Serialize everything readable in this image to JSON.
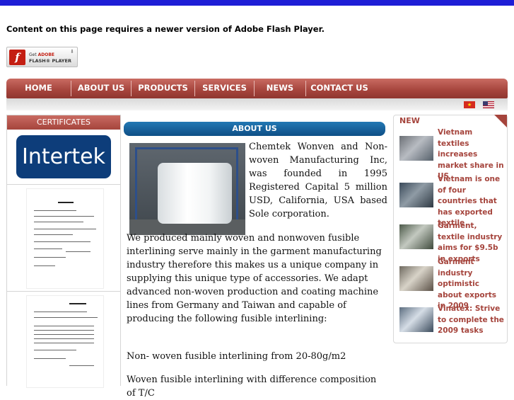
{
  "flash": {
    "message": "Content on this page requires a newer version of Adobe Flash Player.",
    "button_line1": "Get",
    "button_adobe": "ADOBE",
    "button_line2": "FLASH® PLAYER",
    "logo_letter": "f"
  },
  "nav": {
    "items": [
      {
        "label": "HOME"
      },
      {
        "label": "ABOUT US"
      },
      {
        "label": "PRODUCTS"
      },
      {
        "label": "SERVICES"
      },
      {
        "label": "NEWS"
      },
      {
        "label": "CONTACT US"
      }
    ]
  },
  "flags": [
    "flag-vn-icon",
    "flag-us-icon"
  ],
  "certificates": {
    "heading": "CERTIFICATES",
    "logo_text": "Intertek"
  },
  "about": {
    "heading": "ABOUT US",
    "p1": "Chemtek Wonven and Non-woven Manufacturing Inc, was founded in 1995 Registered Capital 5 million USD, California, USA based Sole corporation.",
    "p2": "We produced mainly woven and nonwoven fusible interlining serve mainly in the garment manufacturing industry therefore this makes us a unique company in supplying this unique type of accessories. We adapt advanced non-woven production and coating machine lines from Germany and Taiwan and capable of producing the following fusible interlining:",
    "p3": "Non- woven fusible interlining from 20-80g/m2",
    "p4": "Woven fusible interlining with difference composition of T/C"
  },
  "news": {
    "heading": "NEW",
    "items": [
      {
        "title": "Vietnam textiles increases market share in US"
      },
      {
        "title": "Vietnam is one of four countries that has exported textile"
      },
      {
        "title": "Garment, textile industry aims for $9.5b in exports"
      },
      {
        "title": "Garment industry optimistic about exports in 2009"
      },
      {
        "title": "Vinatex: Strive to complete the 2009 tasks"
      }
    ]
  },
  "colors": {
    "nav_red": "#a5443c",
    "top_blue": "#1e1ed6",
    "about_blue": "#0e4f86",
    "intertek_blue": "#0d3d7a"
  }
}
